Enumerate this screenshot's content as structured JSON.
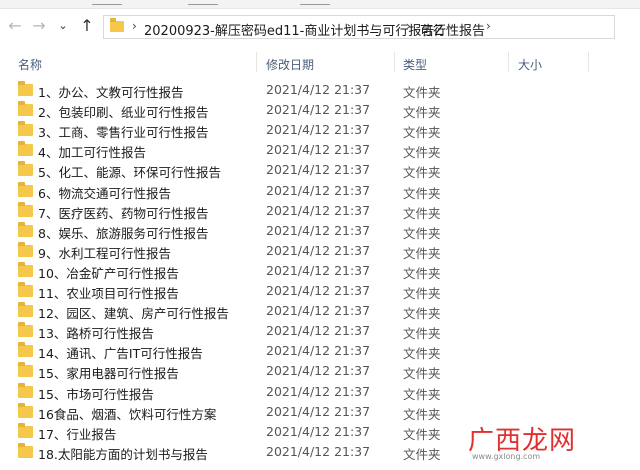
{
  "breadcrumb": {
    "parts": [
      "20200923-解压密码ed11-商业计划书与可行报告Z",
      "可行性报告"
    ]
  },
  "columns": {
    "name": "名称",
    "date": "修改日期",
    "type": "类型",
    "size": "大小"
  },
  "files": [
    {
      "name": "1、办公、文教可行性报告",
      "date": "2021/4/12 21:37",
      "type": "文件夹"
    },
    {
      "name": "2、包装印刷、纸业可行性报告",
      "date": "2021/4/12 21:37",
      "type": "文件夹"
    },
    {
      "name": "3、工商、零售行业可行性报告",
      "date": "2021/4/12 21:37",
      "type": "文件夹"
    },
    {
      "name": "4、加工可行性报告",
      "date": "2021/4/12 21:37",
      "type": "文件夹"
    },
    {
      "name": "5、化工、能源、环保可行性报告",
      "date": "2021/4/12 21:37",
      "type": "文件夹"
    },
    {
      "name": "6、物流交通可行性报告",
      "date": "2021/4/12 21:37",
      "type": "文件夹"
    },
    {
      "name": "7、医疗医药、药物可行性报告",
      "date": "2021/4/12 21:37",
      "type": "文件夹"
    },
    {
      "name": "8、娱乐、旅游服务可行性报告",
      "date": "2021/4/12 21:37",
      "type": "文件夹"
    },
    {
      "name": "9、水利工程可行性报告",
      "date": "2021/4/12 21:37",
      "type": "文件夹"
    },
    {
      "name": "10、冶金矿产可行性报告",
      "date": "2021/4/12 21:37",
      "type": "文件夹"
    },
    {
      "name": "11、农业项目可行性报告",
      "date": "2021/4/12 21:37",
      "type": "文件夹"
    },
    {
      "name": "12、园区、建筑、房产可行性报告",
      "date": "2021/4/12 21:37",
      "type": "文件夹"
    },
    {
      "name": "13、路桥可行性报告",
      "date": "2021/4/12 21:37",
      "type": "文件夹"
    },
    {
      "name": "14、通讯、广告IT可行性报告",
      "date": "2021/4/12 21:37",
      "type": "文件夹"
    },
    {
      "name": "15、家用电器可行性报告",
      "date": "2021/4/12 21:37",
      "type": "文件夹"
    },
    {
      "name": "15、市场可行性报告",
      "date": "2021/4/12 21:37",
      "type": "文件夹"
    },
    {
      "name": "16食品、烟酒、饮料可行性方案",
      "date": "2021/4/12 21:37",
      "type": "文件夹"
    },
    {
      "name": "17、行业报告",
      "date": "2021/4/12 21:37",
      "type": "文件夹"
    },
    {
      "name": "18.太阳能方面的计划书与报告",
      "date": "2021/4/12 21:37",
      "type": "文件夹"
    }
  ],
  "watermark": {
    "brand": "广西龙网",
    "url": "www.gxlong.com"
  },
  "colors": {
    "folder": "#f5c84c",
    "header_text": "#4a5f7a",
    "watermark": "#e0302f"
  }
}
